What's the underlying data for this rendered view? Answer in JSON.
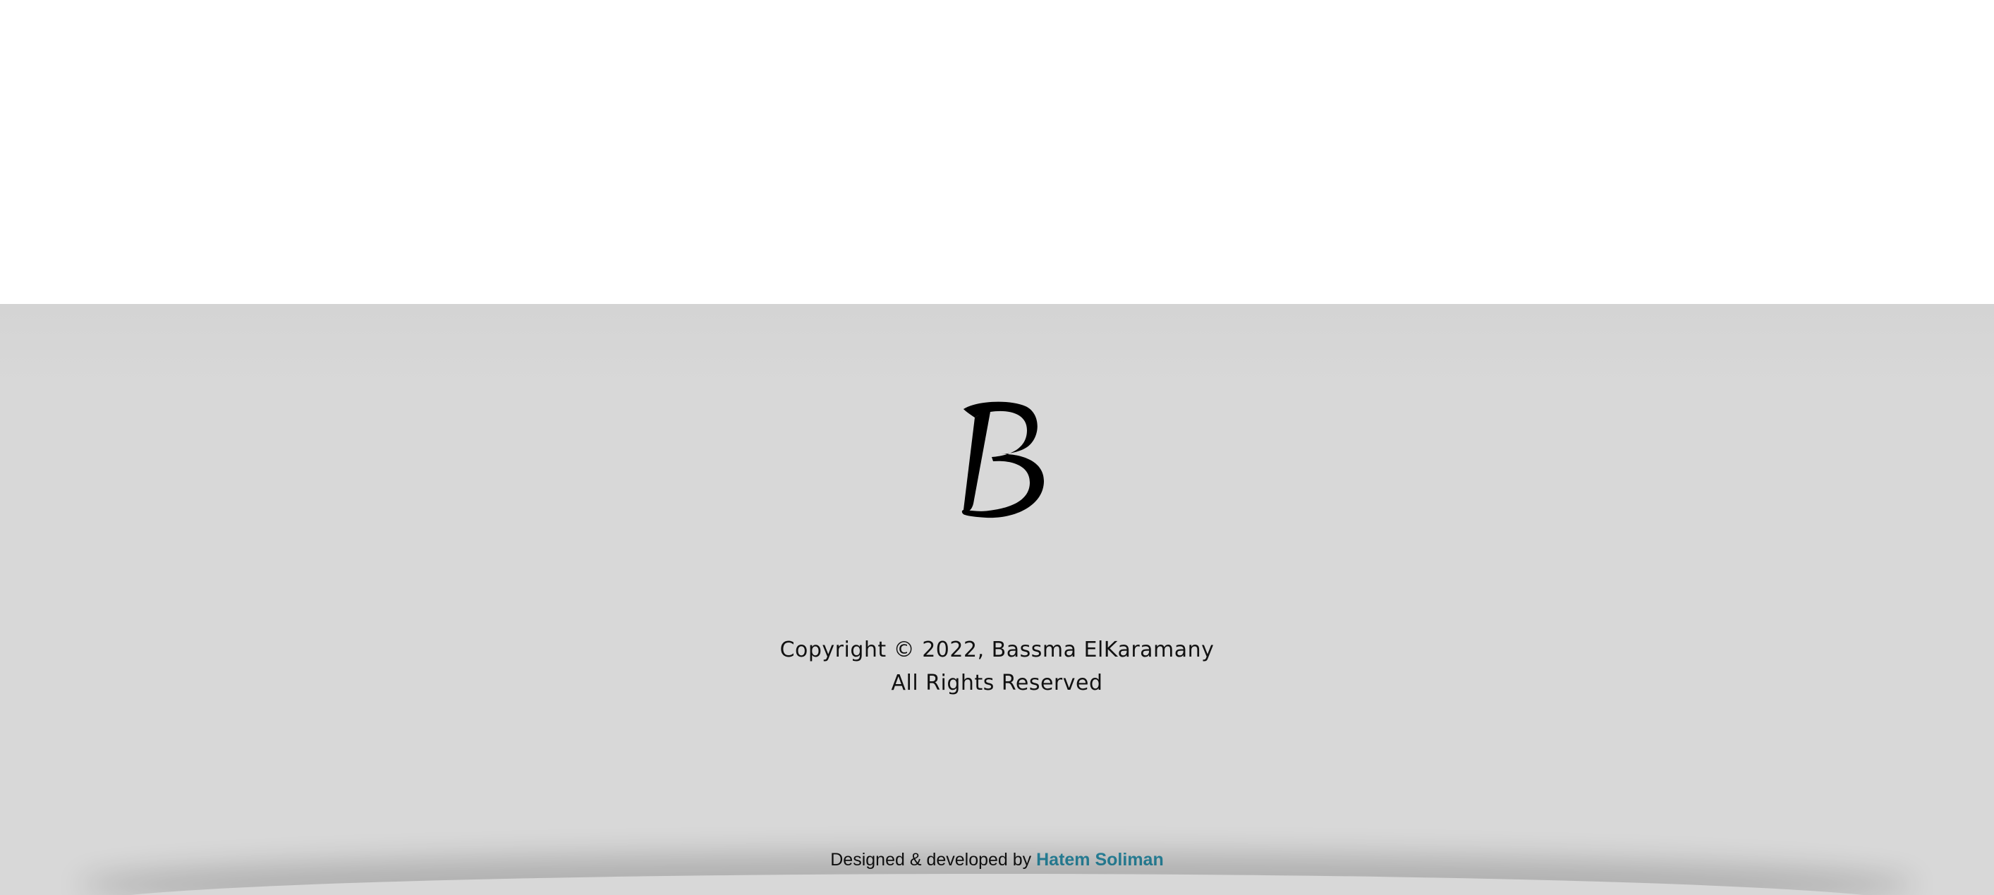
{
  "footer": {
    "logo": {
      "letter": "B",
      "icon": "monogram-b-logo"
    },
    "copyright_line1": "Copyright © 2022, Bassma ElKaramany",
    "copyright_line2": "All Rights Reserved",
    "credit_prefix": "Designed & developed by",
    "credit_author": "Hatem Soliman",
    "colors": {
      "background": "#d8d8d8",
      "text": "#111111",
      "link": "#2a8aa3"
    }
  }
}
